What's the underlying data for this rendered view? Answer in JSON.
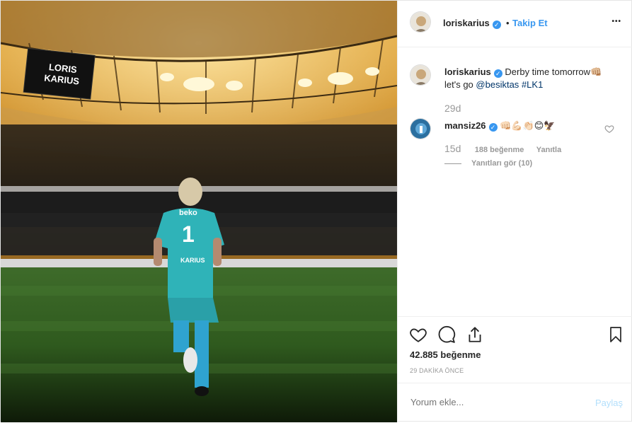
{
  "photo": {
    "banner_text": "LORIS KARIUS",
    "jersey_number": "1",
    "jersey_name": "KARIUS",
    "sponsor": "beko"
  },
  "header": {
    "username": "loriskarius",
    "separator": "•",
    "follow_label": "Takip Et",
    "more_label": "•••"
  },
  "caption": {
    "username": "loriskarius",
    "text": "Derby time tomorrow👊🏼 let's go",
    "mention": "@besiktas",
    "hashtag": "#LK1",
    "age": "29d"
  },
  "comments": [
    {
      "username": "mansiz26",
      "text": "👊🏻💪🏻👏🏻😊🦅",
      "age": "15d",
      "likes": "188 beğenme",
      "reply_label": "Yanıtla",
      "view_replies": "Yanıtları gör (10)"
    }
  ],
  "actions": {
    "likes": "42.885 beğenme",
    "time_ago": "29 DAKİKA ÖNCE"
  },
  "add_comment": {
    "placeholder": "Yorum ekle...",
    "post_label": "Paylaş"
  },
  "colors": {
    "link_blue": "#3897f0",
    "mention_blue": "#003569",
    "muted": "#999999",
    "border": "#efefef"
  }
}
